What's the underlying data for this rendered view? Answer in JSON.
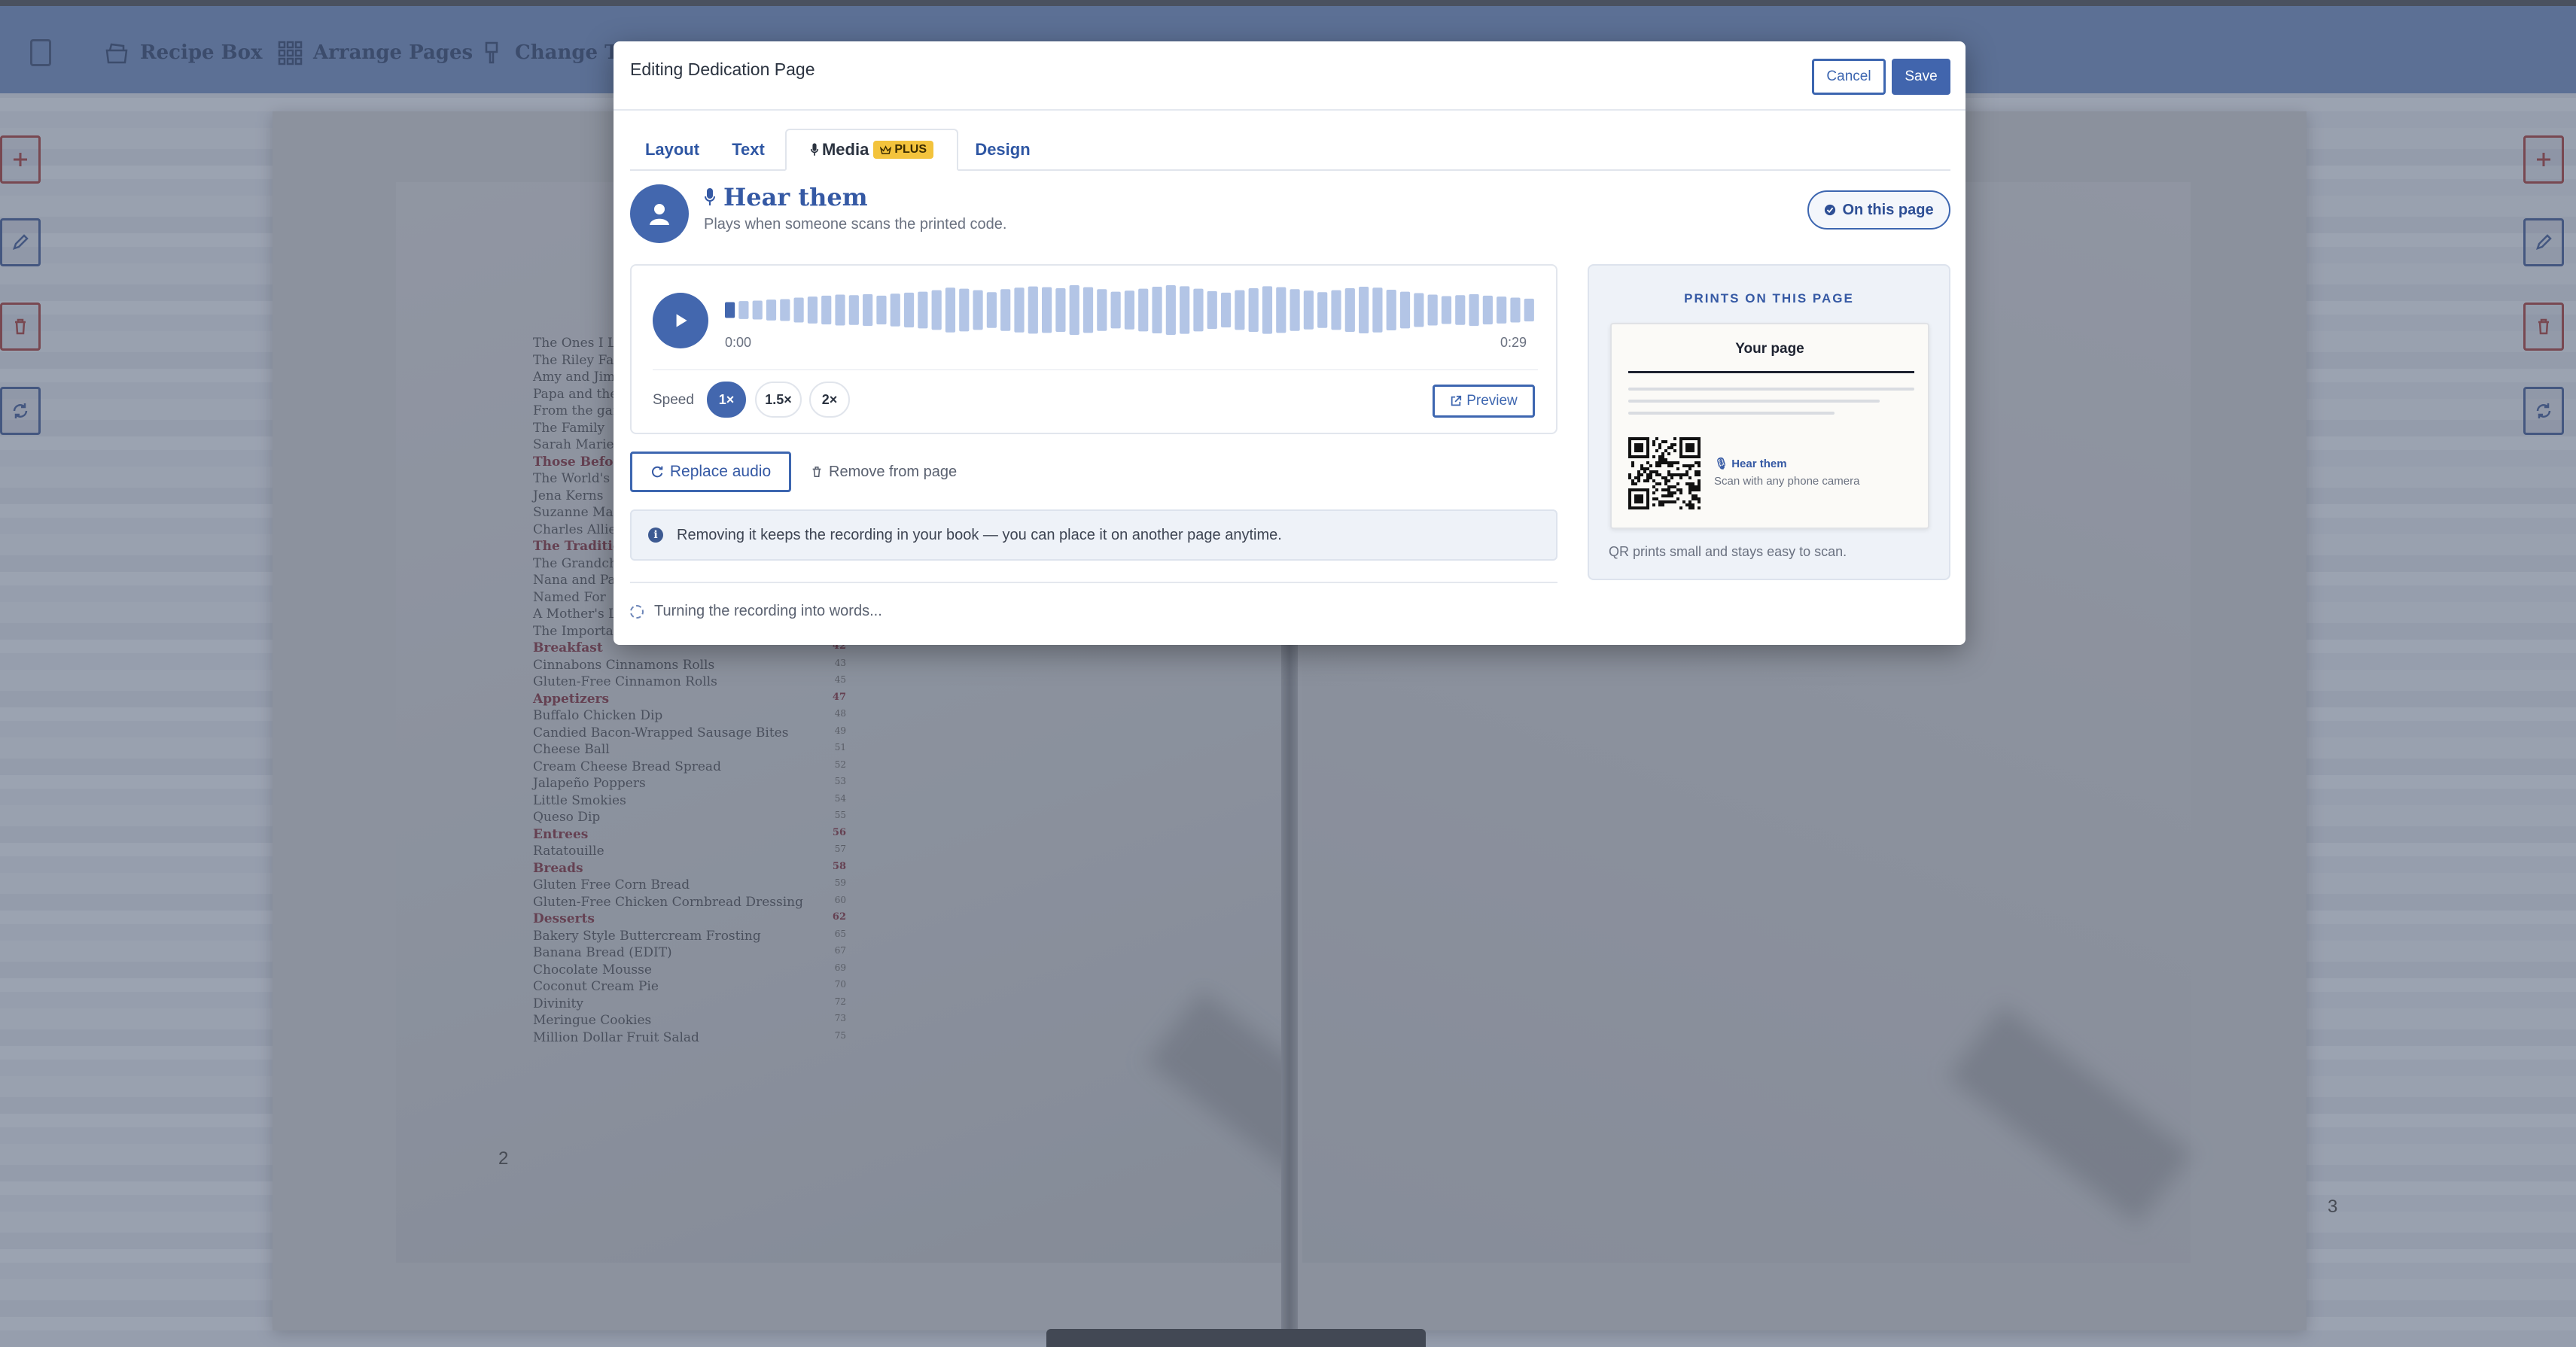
{
  "toolbar": {
    "items": [
      {
        "label": "Recipe Box",
        "icon": "recipe-box-icon"
      },
      {
        "label": "Arrange Pages",
        "icon": "grid-icon"
      },
      {
        "label": "Change The",
        "icon": "brush-icon"
      }
    ]
  },
  "book": {
    "left_page_number": "2",
    "right_page_number": "3",
    "toc": [
      {
        "label": "The Ones I L",
        "page": "",
        "section": false
      },
      {
        "label": "The Riley Fa",
        "page": "",
        "section": false
      },
      {
        "label": "Amy and Jim",
        "page": "",
        "section": false
      },
      {
        "label": "Papa and the",
        "page": "",
        "section": false
      },
      {
        "label": "From the gar",
        "page": "",
        "section": false
      },
      {
        "label": "The Family",
        "page": "",
        "section": false
      },
      {
        "label": "Sarah Marie",
        "page": "",
        "section": false
      },
      {
        "label": "Those Before",
        "page": "",
        "section": true
      },
      {
        "label": "The World's",
        "page": "",
        "section": false
      },
      {
        "label": "Jena Kerns",
        "page": "",
        "section": false
      },
      {
        "label": "Suzanne Mar",
        "page": "",
        "section": false
      },
      {
        "label": "Charles Allie",
        "page": "",
        "section": false
      },
      {
        "label": "The Traditio",
        "page": "",
        "section": true
      },
      {
        "label": "The Grandch",
        "page": "",
        "section": false
      },
      {
        "label": "Nana and Pa",
        "page": "",
        "section": false
      },
      {
        "label": "Named For",
        "page": "",
        "section": false
      },
      {
        "label": "A Mother's L",
        "page": "",
        "section": false
      },
      {
        "label": "The Importa",
        "page": "",
        "section": false
      },
      {
        "label": "Breakfast",
        "page": "42",
        "section": true
      },
      {
        "label": "Cinnabons Cinnamons Rolls",
        "page": "43",
        "section": false
      },
      {
        "label": "Gluten-Free Cinnamon Rolls",
        "page": "45",
        "section": false
      },
      {
        "label": "Appetizers",
        "page": "47",
        "section": true
      },
      {
        "label": "Buffalo Chicken Dip",
        "page": "48",
        "section": false
      },
      {
        "label": "Candied Bacon-Wrapped Sausage Bites",
        "page": "49",
        "section": false
      },
      {
        "label": "Cheese Ball",
        "page": "51",
        "section": false
      },
      {
        "label": "Cream Cheese Bread Spread",
        "page": "52",
        "section": false
      },
      {
        "label": "Jalapeño Poppers",
        "page": "53",
        "section": false
      },
      {
        "label": "Little Smokies",
        "page": "54",
        "section": false
      },
      {
        "label": "Queso Dip",
        "page": "55",
        "section": false
      },
      {
        "label": "Entrees",
        "page": "56",
        "section": true
      },
      {
        "label": "Ratatouille",
        "page": "57",
        "section": false
      },
      {
        "label": "Breads",
        "page": "58",
        "section": true
      },
      {
        "label": "Gluten Free Corn Bread",
        "page": "59",
        "section": false
      },
      {
        "label": "Gluten-Free Chicken Cornbread Dressing",
        "page": "60",
        "section": false
      },
      {
        "label": "Desserts",
        "page": "62",
        "section": true
      },
      {
        "label": "Bakery Style Buttercream Frosting",
        "page": "65",
        "section": false
      },
      {
        "label": "Banana Bread (EDIT)",
        "page": "67",
        "section": false
      },
      {
        "label": "Chocolate Mousse",
        "page": "69",
        "section": false
      },
      {
        "label": "Coconut Cream Pie",
        "page": "70",
        "section": false
      },
      {
        "label": "Divinity",
        "page": "72",
        "section": false
      },
      {
        "label": "Meringue Cookies",
        "page": "73",
        "section": false
      },
      {
        "label": "Million Dollar Fruit Salad",
        "page": "75",
        "section": false
      }
    ]
  },
  "modal": {
    "title": "Editing Dedication Page",
    "cancel_label": "Cancel",
    "save_label": "Save",
    "tabs": {
      "layout": "Layout",
      "text": "Text",
      "media": "Media",
      "media_badge": "PLUS",
      "design": "Design"
    },
    "media": {
      "title": "Hear them",
      "subtitle": "Plays when someone scans the printed code.",
      "on_page_label": "On this page",
      "player": {
        "time_start": "0:00",
        "time_end": "0:29",
        "progress": 0.01,
        "speed_label": "Speed",
        "speeds": [
          "1×",
          "1.5×",
          "2×"
        ],
        "selected_speed": "1×",
        "preview_label": "Preview",
        "waveform": [
          0.32,
          0.36,
          0.38,
          0.42,
          0.44,
          0.5,
          0.54,
          0.58,
          0.62,
          0.6,
          0.64,
          0.58,
          0.66,
          0.7,
          0.74,
          0.8,
          0.9,
          0.86,
          0.8,
          0.72,
          0.84,
          0.9,
          0.95,
          0.92,
          0.88,
          1.0,
          0.92,
          0.84,
          0.74,
          0.78,
          0.86,
          0.94,
          1.0,
          0.96,
          0.86,
          0.76,
          0.7,
          0.8,
          0.88,
          0.96,
          0.92,
          0.84,
          0.78,
          0.72,
          0.8,
          0.88,
          0.94,
          0.9,
          0.82,
          0.74,
          0.68,
          0.62,
          0.56,
          0.6,
          0.64,
          0.58,
          0.54,
          0.5,
          0.46
        ]
      },
      "replace_label": "Replace audio",
      "remove_label": "Remove from page",
      "info_text": "Removing it keeps the recording in your book — you can place it on another page anytime.",
      "status_text": "Turning the recording into words..."
    },
    "prints": {
      "title": "PRINTS ON THIS PAGE",
      "page_title": "Your page",
      "qr_label": "Hear them",
      "qr_sub": "Scan with any phone camera",
      "note": "QR prints small and stays easy to scan."
    }
  },
  "colors": {
    "accent": "#4367ae",
    "plus_badge": "#f3c33c",
    "section_heading": "#6b2230"
  }
}
